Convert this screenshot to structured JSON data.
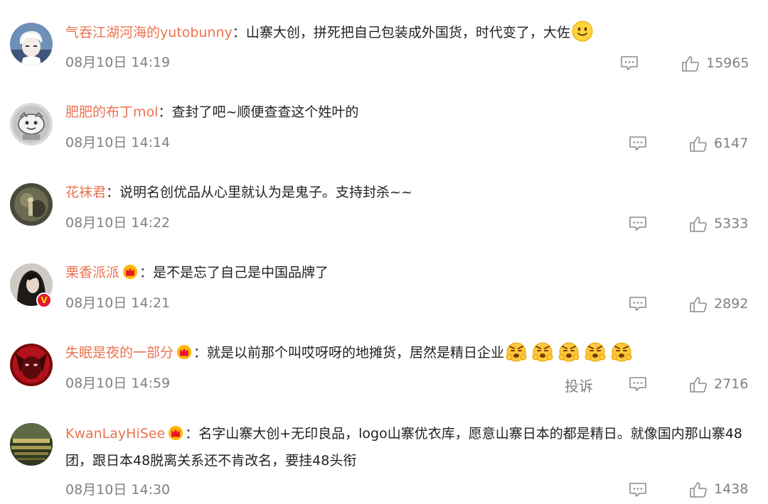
{
  "comments": [
    {
      "username": "气吞江湖河海的yutobunny",
      "separator": "：",
      "text": "山寨大创，拼死把自己包装成外国货，时代变了，大佐",
      "time": "08月10日 14:19",
      "likes": "15965",
      "avatar_icon": "white-haired-anime-avatar",
      "emoji_icon": "smile-emoji",
      "color_accent": "#eb7350"
    },
    {
      "username": "肥肥的布丁mol",
      "separator": "：",
      "text": "查封了吧~顺便查查这个姓叶的",
      "time": "08月10日 14:14",
      "likes": "6147",
      "avatar_icon": "grey-cartoon-avatar"
    },
    {
      "username": "花袜君",
      "separator": "：",
      "text": "说明名创优品从心里就认为是鬼子。支持封杀~~",
      "time": "08月10日 14:22",
      "likes": "5333",
      "avatar_icon": "dark-photo-avatar"
    },
    {
      "username": "栗香派派",
      "separator": "：",
      "text": "是不是忘了自己是中国品牌了",
      "time": "08月10日 14:21",
      "likes": "2892",
      "avatar_icon": "dark-hair-avatar",
      "badge_icon": "crown-fan-badge-icon",
      "verified_icon": "v-verified-icon",
      "verified_text": "V"
    },
    {
      "username": "失眠是夜的一部分",
      "separator": "：",
      "text": "就是以前那个叫哎呀呀的地摊货，居然是精日企业",
      "time": "08月10日 14:59",
      "likes": "2716",
      "report": "投诉",
      "avatar_icon": "red-face-avatar",
      "badge_icon": "crown-fan-badge-icon",
      "emoji_icon": "angry-emoji",
      "emoji_count": 5
    },
    {
      "username": "KwanLayHiSee",
      "separator": "：",
      "text": "名字山寨大创+无印良品，logo山寨优衣库，愿意山寨日本的都是精日。就像国内那山寨48团，跟日本48脱离关系还不肯改名，要挂48头衔",
      "time": "08月10日 14:30",
      "likes": "1438",
      "avatar_icon": "city-photo-avatar",
      "badge_icon": "crown-fan-badge-icon"
    }
  ],
  "icons": {
    "comment": "comment-icon",
    "like": "thumbs-up-icon"
  },
  "colors": {
    "username": "#eb7350",
    "meta": "#808080",
    "text": "#222222"
  }
}
